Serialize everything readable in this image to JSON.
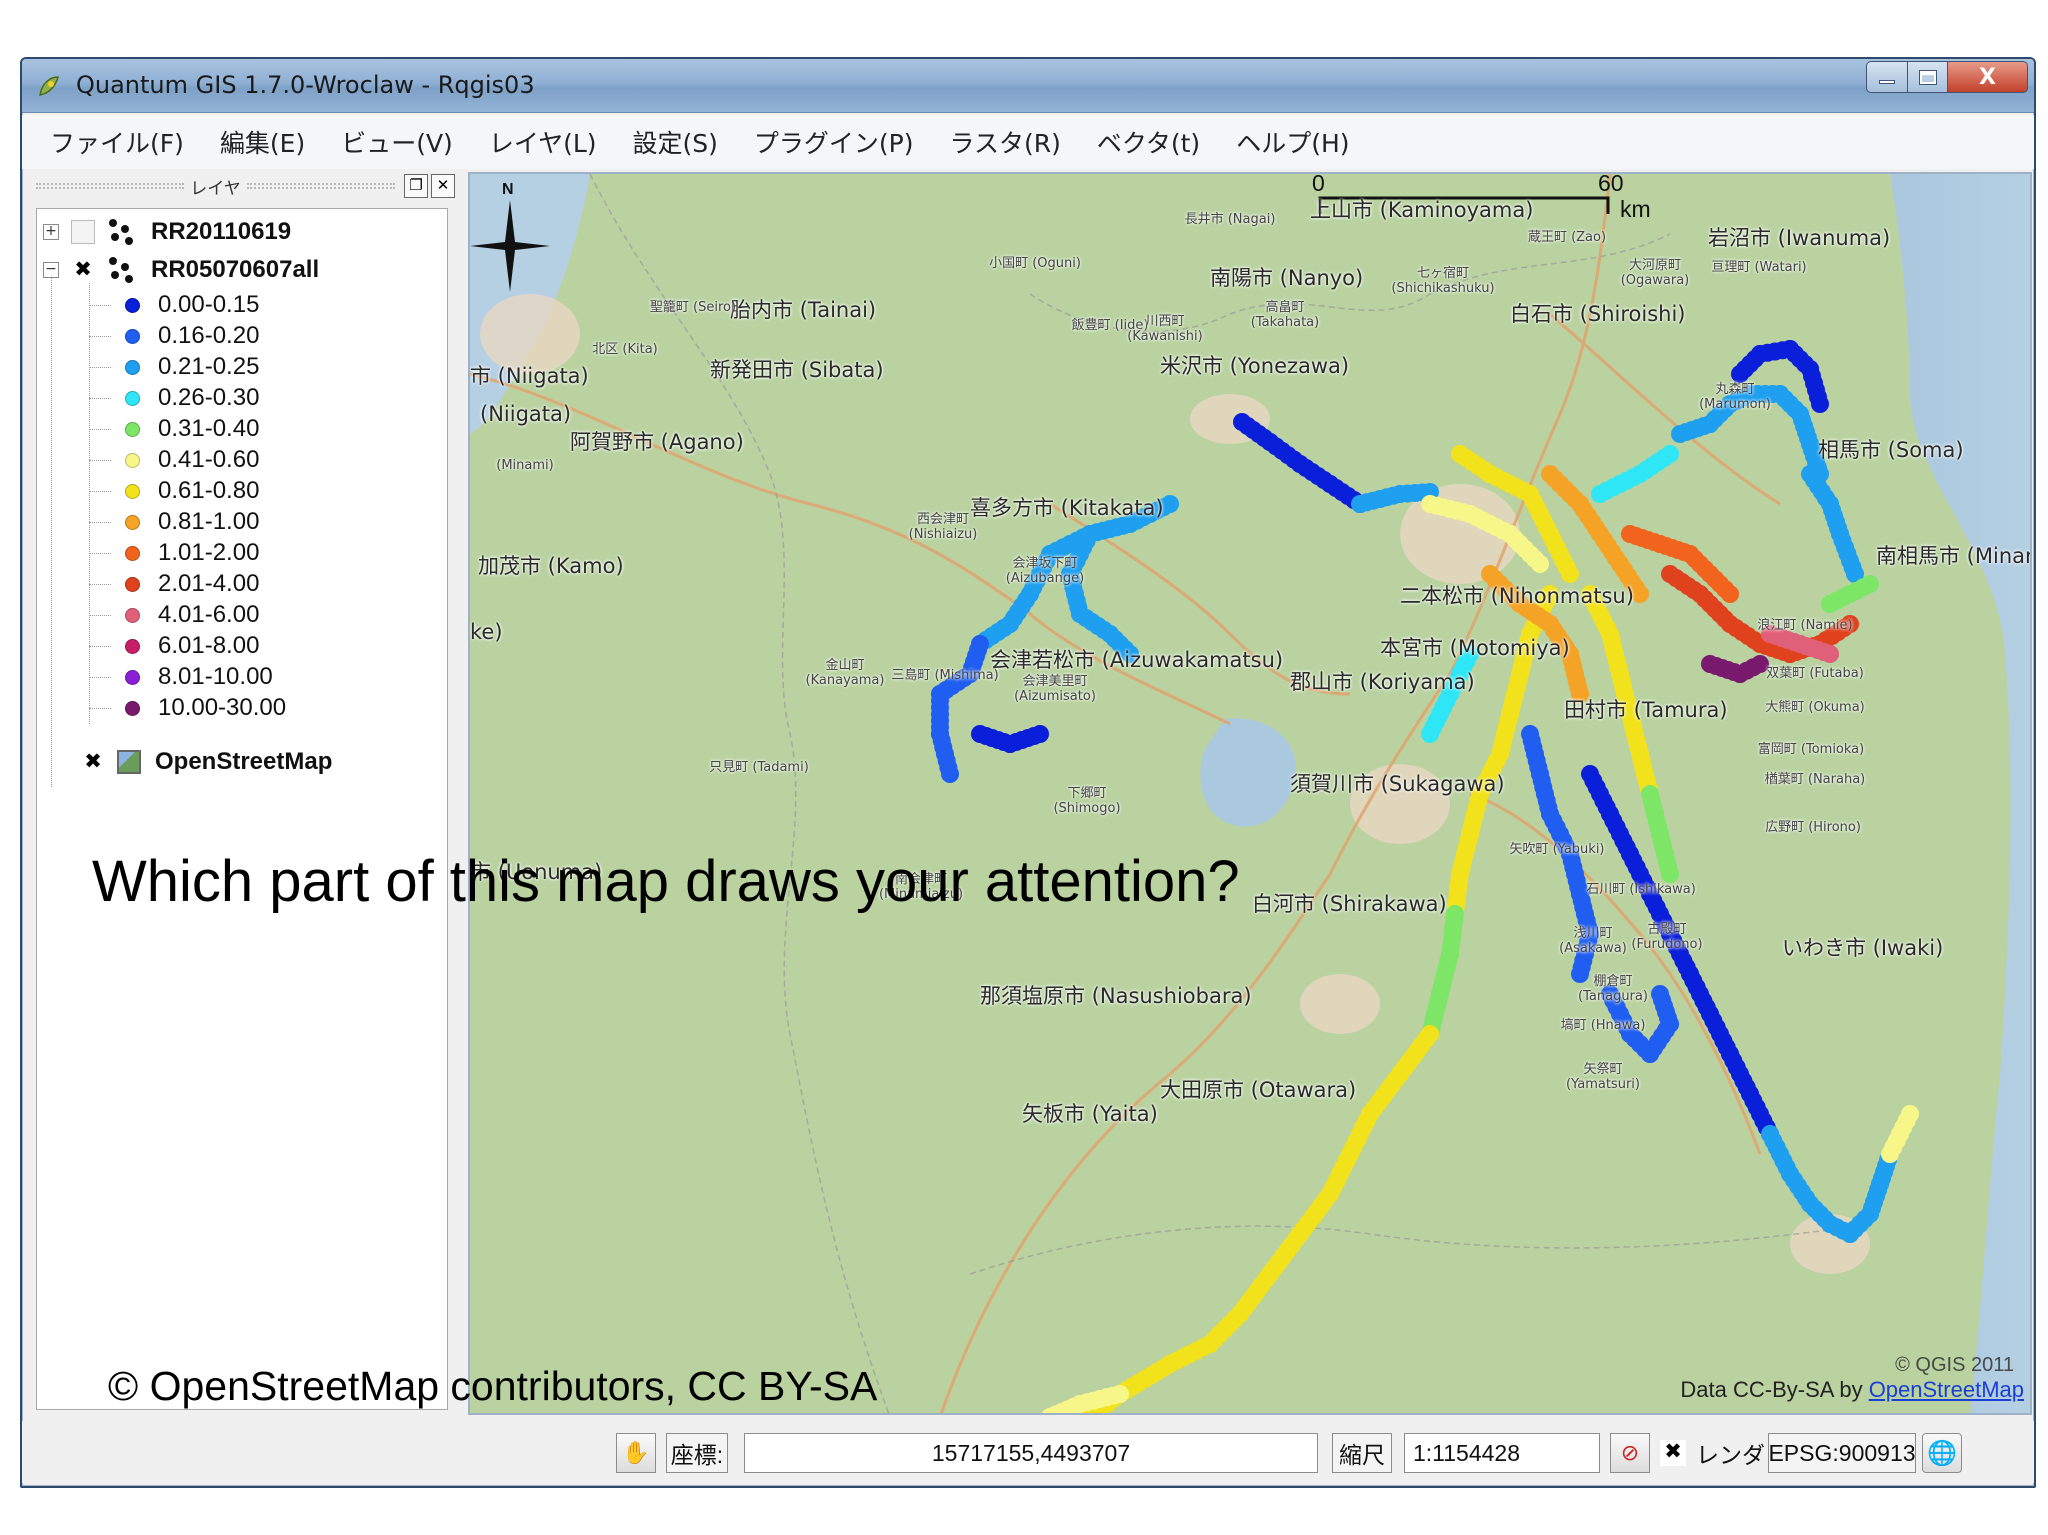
{
  "window": {
    "title": "Quantum GIS 1.7.0-Wroclaw - Rqgis03",
    "controls": {
      "minimize_icon": "minimize-icon",
      "maximize_icon": "maximize-icon",
      "close_label": "X"
    }
  },
  "menubar": {
    "items": [
      "ファイル(F)",
      "編集(E)",
      "ビュー(V)",
      "レイヤ(L)",
      "設定(S)",
      "プラグイン(P)",
      "ラスタ(R)",
      "ベクタ(t)",
      "ヘルプ(H)"
    ]
  },
  "layer_panel": {
    "title": "レイヤ",
    "layers": [
      {
        "name": "RR20110619",
        "expanded": false,
        "checked": false,
        "icon": "point-layer-icon"
      },
      {
        "name": "RR05070607all",
        "expanded": true,
        "checked": true,
        "icon": "point-layer-icon"
      },
      {
        "name": "OpenStreetMap",
        "checked": true,
        "icon": "raster-layer-icon"
      }
    ],
    "legend": [
      {
        "label": "0.00-0.15",
        "color": "#0a1fd9"
      },
      {
        "label": "0.16-0.20",
        "color": "#1f5ef0"
      },
      {
        "label": "0.21-0.25",
        "color": "#1e9ff0"
      },
      {
        "label": "0.26-0.30",
        "color": "#2ee6f5"
      },
      {
        "label": "0.31-0.40",
        "color": "#7de667"
      },
      {
        "label": "0.41-0.60",
        "color": "#f7f789"
      },
      {
        "label": "0.61-0.80",
        "color": "#f2e21c"
      },
      {
        "label": "0.81-1.00",
        "color": "#f5a326"
      },
      {
        "label": "1.01-2.00",
        "color": "#f2641e"
      },
      {
        "label": "2.01-4.00",
        "color": "#e0421e"
      },
      {
        "label": "4.01-6.00",
        "color": "#e0607a"
      },
      {
        "label": "6.01-8.00",
        "color": "#c81e6a"
      },
      {
        "label": "8.01-10.00",
        "color": "#8b1fd6"
      },
      {
        "label": "10.00-30.00",
        "color": "#7a1a6e"
      }
    ]
  },
  "map": {
    "scalebar": {
      "zero": "0",
      "max": "60",
      "unit": "km"
    },
    "places": [
      "上山市 (Kaminoyama)",
      "岩沼市 (Iwanuma)",
      "南陽市 (Nanyo)",
      "白石市 (Shiroishi)",
      "胎内市 (Tainai)",
      "新発田市 (Sibata)",
      "市 (Niigata)",
      "(Niigata)",
      "米沢市 (Yonezawa)",
      "阿賀野市 (Agano)",
      "喜多方市 (Kitakata)",
      "加茂市 (Kamo)",
      "相馬市 (Soma)",
      "南相馬市 (Minamisoma)",
      "二本松市 (Nihonmatsu)",
      "本宮市 (Motomiya)",
      "会津若松市 (Aizuwakamatsu)",
      "郡山市 (Koriyama)",
      "田村市 (Tamura)",
      "須賀川市 (Sukagawa)",
      "市 (Uonuma)",
      "白河市 (Shirakawa)",
      "いわき市 (Iwaki)",
      "那須塩原市 (Nasushiobara)",
      "大田原市 (Otawara)",
      "矢板市 (Yaita)",
      "ke)"
    ],
    "small_places": [
      "長井市 (Nagai)",
      "小国町 (Oguni)",
      "聖籠町 (Seiro)",
      "北区 (Kita)",
      "飯豊町 (Iide)",
      "川西町 (Kawanishi)",
      "高畠町 (Takahata)",
      "七ヶ宿町 (Shichikashuku)",
      "蔵王町 (Zao)",
      "大河原町 (Ogawara)",
      "亘理町 (Watari)",
      "(Minami)",
      "丸森町 (Marumon)",
      "西会津町 (Nishiaizu)",
      "会津坂下町 (Aizubange)",
      "金山町 (Kanayama)",
      "三島町 (Mishima)",
      "会津美里町 (Aizumisato)",
      "只見町 (Tadami)",
      "下郷町 (Shimogo)",
      "南会津町 (Minamiaizu)",
      "浪江町 (Namie)",
      "双葉町 (Futaba)",
      "大熊町 (Okuma)",
      "富岡町 (Tomioka)",
      "楢葉町 (Naraha)",
      "広野町 (Hirono)",
      "石川町 (Ishikawa)",
      "浅川町 (Asakawa)",
      "古殿町 (Furudono)",
      "棚倉町 (Tanagura)",
      "塙町 (Hnawa)",
      "矢祭町 (Yamatsuri)",
      "矢吹町 (Yabuki)"
    ],
    "attribution_prefix": "Data CC-By-SA by ",
    "attribution_link": "OpenStreetMap",
    "qgis_copyright": "© QGIS 2011",
    "north_label": "N"
  },
  "statusbar": {
    "coord_label": "座標:",
    "coordinates": "15717155,4493707",
    "scale_label": "縮尺",
    "scale_value": "1:1154428",
    "render_label": "レンダ",
    "render_checked": true,
    "crs": "EPSG:900913"
  },
  "overlay": {
    "question": "Which part of this map draws your attention?",
    "credit": "© OpenStreetMap contributors, CC BY-SA"
  }
}
